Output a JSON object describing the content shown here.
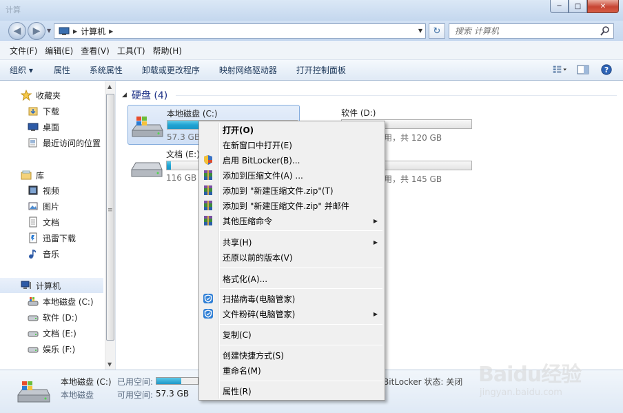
{
  "window": {
    "title_ghost": "计算",
    "controls": {
      "minimize": "─",
      "maximize": "□",
      "close": "✕"
    }
  },
  "address": {
    "crumb": "计算机",
    "search_placeholder": "搜索 计算机"
  },
  "menubar": {
    "items": [
      "文件(F)",
      "编辑(E)",
      "查看(V)",
      "工具(T)",
      "帮助(H)"
    ]
  },
  "commandbar": {
    "items": [
      "组织 ▾",
      "属性",
      "系统属性",
      "卸载或更改程序",
      "映射网络驱动器",
      "打开控制面板"
    ]
  },
  "nav": {
    "favorites": {
      "label": "收藏夹",
      "items": [
        "下载",
        "桌面",
        "最近访问的位置"
      ]
    },
    "libraries": {
      "label": "库",
      "items": [
        "视频",
        "图片",
        "文档",
        "迅雷下载",
        "音乐"
      ]
    },
    "computer": {
      "label": "计算机",
      "items": [
        "本地磁盘 (C:)",
        "软件 (D:)",
        "文档 (E:)",
        "娱乐 (F:)"
      ]
    }
  },
  "content": {
    "group_header": "硬盘 (4)",
    "drives": [
      {
        "name": "本地磁盘 (C:)",
        "size_text": "57.3 GB",
        "used_fraction": 0.55,
        "selected": true
      },
      {
        "name": "软件 (D:)",
        "size_text": "用，共 120 GB",
        "used_fraction": 0.0,
        "selected": false
      },
      {
        "name": "文档 (E:)",
        "size_text": "116 GB",
        "used_fraction": 0.03,
        "selected": false
      },
      {
        "name": "",
        "size_text": "用，共 145 GB",
        "used_fraction": 0.0,
        "selected": false
      }
    ]
  },
  "details": {
    "name": "本地磁盘 (C:)",
    "type": "本地磁盘",
    "used_label": "已用空间:",
    "free_label": "可用空间:",
    "free_value": "57.3 GB",
    "bitlocker": "BitLocker 状态: 关闭",
    "used_fraction": 0.6
  },
  "context_menu": {
    "items": [
      {
        "label": "打开(O)",
        "bold": true
      },
      {
        "label": "在新窗口中打开(E)"
      },
      {
        "label": "启用 BitLocker(B)...",
        "icon": "shield-icon"
      },
      {
        "label": "添加到压缩文件(A) ...",
        "icon": "archive-icon"
      },
      {
        "label": "添加到 \"新建压缩文件.zip\"(T)",
        "icon": "archive-icon"
      },
      {
        "label": "添加到 \"新建压缩文件.zip\" 并邮件",
        "icon": "archive-icon"
      },
      {
        "label": "其他压缩命令",
        "icon": "archive-icon",
        "submenu": true
      },
      {
        "label": "共享(H)",
        "submenu": true
      },
      {
        "label": "还原以前的版本(V)"
      },
      {
        "label": "格式化(A)..."
      },
      {
        "label": "扫描病毒(电脑管家)",
        "icon": "guard-icon"
      },
      {
        "label": "文件粉碎(电脑管家)",
        "icon": "guard-icon",
        "submenu": true
      },
      {
        "label": "复制(C)"
      },
      {
        "label": "创建快捷方式(S)"
      },
      {
        "label": "重命名(M)"
      },
      {
        "label": "属性(R)"
      }
    ]
  },
  "watermark": {
    "logo": "Baidu经验",
    "site": "jingyan.baidu.com"
  },
  "colors": {
    "accent": "#1e3287",
    "bar_fill": "#21a4d4",
    "selection": "#cfdff5"
  }
}
